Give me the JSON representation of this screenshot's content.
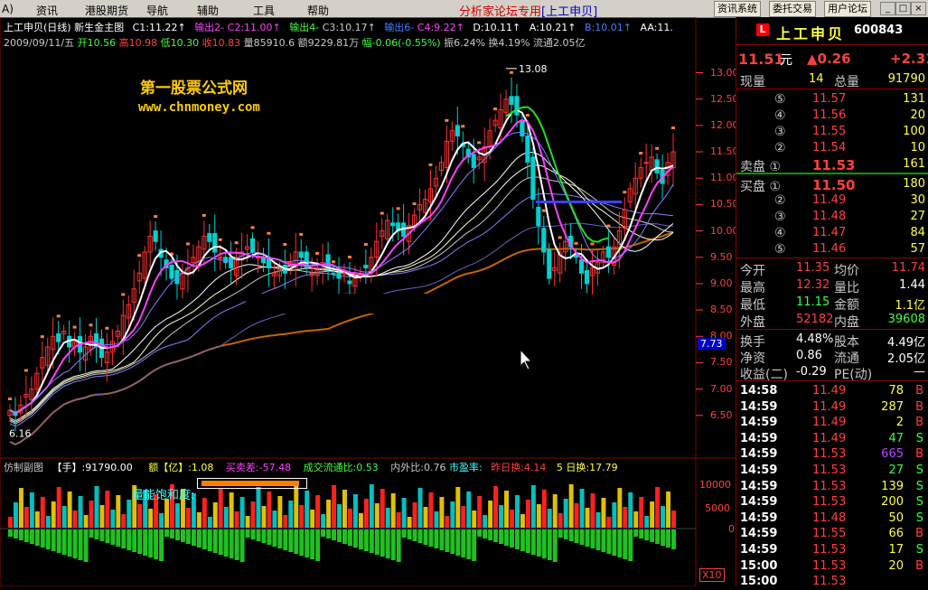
{
  "menu": {
    "items": [
      "A)",
      "资讯",
      "港股期货",
      "导航",
      "辅助",
      "工具",
      "帮助"
    ],
    "promo": "分析家论坛专用",
    "promo_bracket": "[上工申贝]",
    "buttons": [
      "资讯系统",
      "委托交易",
      "用户论坛"
    ],
    "window_buttons": [
      "_",
      "□",
      "×"
    ]
  },
  "chart_header": {
    "line1": [
      "上工申贝(日线) 新生金主图",
      "C1:11.22↑",
      "输出2-",
      "C2:11.00↑",
      "输出4-",
      "C3:10.17↑",
      "输出6-",
      "C4:9.22↑",
      "D:10.11↑",
      "A:10.21↑",
      "B:10.01↑",
      "AA:11."
    ],
    "line2_date": "2009/09/11/五",
    "line2_open": "开10.56",
    "line2_high": "高10.98",
    "line2_low": "低10.30",
    "line2_close": "收10.83",
    "line2_vol": "量85910.6",
    "line2_amt": "额9229.81万",
    "line2_chg": "幅-0.06(-0.55%)",
    "line2_amp": "振6.24%",
    "line2_turn": "换4.19%",
    "line2_float": "流通2.05亿"
  },
  "watermark": {
    "title": "第一股票公式网",
    "url": "www.chnmoney.com"
  },
  "price_axis": [
    "13.00",
    "12.50",
    "12.00",
    "11.50",
    "11.00",
    "10.50",
    "10.00",
    "9.50",
    "9.00",
    "8.50",
    "8.00",
    "7.50",
    "7.00",
    "6.50"
  ],
  "price_current_badge": "7.73",
  "high_marker": "13.08",
  "low_marker": "6.16",
  "sub_header": {
    "name": "仿制副图",
    "hand": "【手】:91790.00",
    "amount": "额【亿】:1.08",
    "buysell": "买卖差:-57.48",
    "ratio": "成交流通比:0.53",
    "inout": "内外比:0.76",
    "pe": "市盈率:",
    "prev_turn": "昨日换:4.14",
    "five_turn": "5 日换:17.79",
    "saturation": "量能饱和度:"
  },
  "sub_axis": [
    "10000",
    "5000",
    "0"
  ],
  "sub_unit": "X10",
  "quote": {
    "logo": "L",
    "name": "上工申贝",
    "code": "600843",
    "price": "11.51",
    "unit": "元",
    "change": "▲0.26",
    "change_pct": "+2.31",
    "vol_label": "现量",
    "vol_value": "14",
    "total_label": "总量",
    "total_value": "91790",
    "sells": [
      {
        "lvl": "⑤",
        "price": "11.57",
        "vol": "131"
      },
      {
        "lvl": "④",
        "price": "11.56",
        "vol": "20"
      },
      {
        "lvl": "③",
        "price": "11.55",
        "vol": "100"
      },
      {
        "lvl": "②",
        "price": "11.54",
        "vol": "10"
      },
      {
        "lvl": "卖盘 ①",
        "price": "11.53",
        "vol": "161"
      }
    ],
    "buys": [
      {
        "lvl": "买盘 ①",
        "price": "11.50",
        "vol": "180"
      },
      {
        "lvl": "②",
        "price": "11.49",
        "vol": "30"
      },
      {
        "lvl": "③",
        "price": "11.48",
        "vol": "27"
      },
      {
        "lvl": "④",
        "price": "11.47",
        "vol": "84"
      },
      {
        "lvl": "⑤",
        "price": "11.46",
        "vol": "57"
      }
    ],
    "stats": [
      {
        "l1": "今开",
        "v1": "11.35",
        "c1": "#ff4040",
        "l2": "均价",
        "v2": "11.74",
        "c2": "#ff4040"
      },
      {
        "l1": "最高",
        "v1": "12.32",
        "c1": "#ff4040",
        "l2": "量比",
        "v2": "1.44",
        "c2": "#ffffff"
      },
      {
        "l1": "最低",
        "v1": "11.15",
        "c1": "#40ff40",
        "l2": "金额",
        "v2": "1.1亿",
        "c2": "#ffff40"
      },
      {
        "l1": "外盘",
        "v1": "52182",
        "c1": "#ff4040",
        "l2": "内盘",
        "v2": "39608",
        "c2": "#40ff40"
      }
    ],
    "stats2": [
      {
        "l1": "换手",
        "v1": "4.48%",
        "l2": "股本",
        "v2": "4.49亿"
      },
      {
        "l1": "净资",
        "v1": "0.86",
        "l2": "流通",
        "v2": "2.05亿"
      },
      {
        "l1": "收益(二)",
        "v1": "-0.29",
        "l2": "PE(动)",
        "v2": "—"
      }
    ],
    "ticks": [
      {
        "t": "14:58",
        "p": "11.49",
        "v": "78",
        "s": "B",
        "pc": "#ff4040",
        "vc": "#ffff40"
      },
      {
        "t": "14:59",
        "p": "11.49",
        "v": "287",
        "s": "B",
        "pc": "#ff4040",
        "vc": "#ffff40"
      },
      {
        "t": "14:59",
        "p": "11.49",
        "v": "2",
        "s": "B",
        "pc": "#ff4040",
        "vc": "#ffff40"
      },
      {
        "t": "14:59",
        "p": "11.49",
        "v": "47",
        "s": "S",
        "pc": "#ff4040",
        "vc": "#40ff40"
      },
      {
        "t": "14:59",
        "p": "11.53",
        "v": "665",
        "s": "B",
        "pc": "#ff4040",
        "vc": "#c040ff"
      },
      {
        "t": "14:59",
        "p": "11.53",
        "v": "27",
        "s": "S",
        "pc": "#ff4040",
        "vc": "#40ff40"
      },
      {
        "t": "14:59",
        "p": "11.53",
        "v": "139",
        "s": "S",
        "pc": "#ff4040",
        "vc": "#ffff40"
      },
      {
        "t": "14:59",
        "p": "11.53",
        "v": "200",
        "s": "S",
        "pc": "#ff4040",
        "vc": "#ffff40"
      },
      {
        "t": "14:59",
        "p": "11.48",
        "v": "50",
        "s": "S",
        "pc": "#ff4040",
        "vc": "#ffff40"
      },
      {
        "t": "14:59",
        "p": "11.55",
        "v": "66",
        "s": "B",
        "pc": "#ff4040",
        "vc": "#ffff40"
      },
      {
        "t": "14:59",
        "p": "11.53",
        "v": "17",
        "s": "S",
        "pc": "#ff4040",
        "vc": "#ffff40"
      },
      {
        "t": "15:00",
        "p": "11.53",
        "v": "20",
        "s": "B",
        "pc": "#ff4040",
        "vc": "#ffff40"
      },
      {
        "t": "15:00",
        "p": "11.53",
        "v": "",
        "s": "",
        "pc": "#ff4040",
        "vc": "#ffff40"
      }
    ]
  },
  "chart_data": {
    "type": "candlestick",
    "price_range": [
      6.0,
      13.3
    ],
    "closes": [
      6.6,
      6.5,
      6.7,
      6.9,
      7.0,
      7.3,
      7.6,
      7.8,
      8.0,
      7.9,
      8.1,
      7.8,
      7.9,
      7.7,
      7.8,
      8.0,
      7.8,
      7.6,
      7.7,
      7.9,
      8.1,
      8.4,
      8.6,
      8.9,
      9.2,
      9.6,
      9.9,
      9.8,
      9.5,
      9.3,
      9.1,
      9.0,
      9.2,
      9.3,
      9.5,
      9.7,
      9.9,
      9.8,
      9.6,
      9.5,
      9.4,
      9.3,
      9.5,
      9.6,
      9.7,
      9.6,
      9.5,
      9.4,
      9.3,
      9.2,
      9.3,
      9.2,
      9.4,
      9.6,
      9.5,
      9.3,
      9.2,
      9.3,
      9.4,
      9.3,
      9.2,
      9.1,
      9.2,
      9.0,
      9.1,
      9.2,
      9.3,
      9.5,
      9.8,
      10.0,
      10.2,
      10.1,
      10.0,
      9.9,
      10.1,
      10.3,
      10.5,
      10.6,
      10.8,
      11.0,
      11.3,
      11.7,
      11.9,
      11.8,
      11.6,
      11.4,
      11.2,
      11.4,
      11.6,
      11.9,
      12.1,
      12.3,
      12.5,
      12.4,
      12.2,
      11.8,
      11.3,
      10.6,
      10.1,
      9.6,
      9.1,
      9.3,
      9.6,
      9.8,
      9.7,
      9.5,
      9.2,
      9.0,
      9.3,
      9.4,
      9.6,
      9.5,
      9.7,
      10.0,
      10.4,
      10.8,
      11.0,
      11.2,
      11.3,
      11.4,
      11.1,
      10.9,
      11.3,
      11.5
    ],
    "ma_labels": [
      "C1",
      "C2",
      "C3",
      "C4",
      "D",
      "A",
      "B"
    ]
  }
}
